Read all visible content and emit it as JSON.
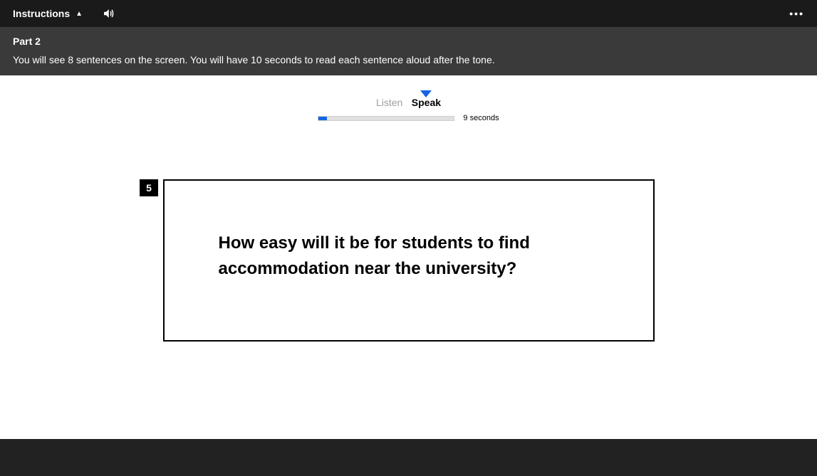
{
  "topbar": {
    "instructions_label": "Instructions"
  },
  "instructions": {
    "part_title": "Part 2",
    "part_desc": "You will see 8 sentences on the screen. You will have 10 seconds to read each sentence aloud after the tone."
  },
  "phase": {
    "listen_label": "Listen",
    "speak_label": "Speak",
    "active": "speak",
    "progress_percent": 6,
    "seconds_text": "9 seconds"
  },
  "question": {
    "number": "5",
    "text": "How easy will it be for students to find accommodation near the university?"
  }
}
